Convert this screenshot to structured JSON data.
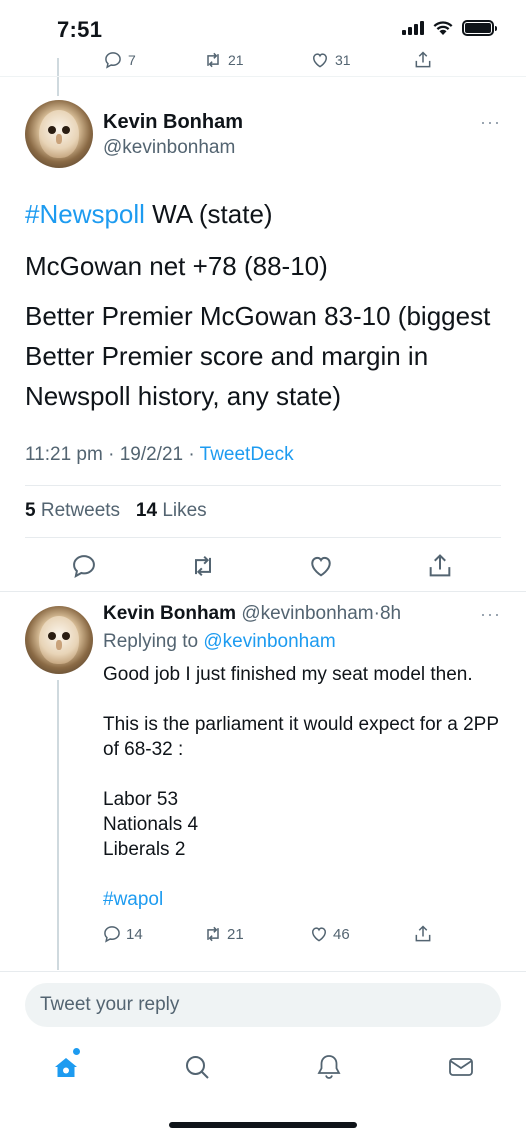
{
  "status_bar": {
    "time": "7:51",
    "icons": [
      "cellular-signal-icon",
      "wifi-icon",
      "battery-icon"
    ]
  },
  "previous_tweet": {
    "actions": [
      {
        "icon": "reply-icon",
        "count": "7"
      },
      {
        "icon": "retweet-icon",
        "count": "21"
      },
      {
        "icon": "like-icon",
        "count": "31"
      },
      {
        "icon": "share-icon",
        "count": ""
      }
    ]
  },
  "main_tweet": {
    "author_name": "Kevin Bonham",
    "author_handle": "@kevinbonham",
    "more": "···",
    "hashtag": "#Newspoll",
    "line1_rest": " WA (state)",
    "line2": "McGowan net +78 (88-10)",
    "line3": "Better Premier McGowan 83-10 (biggest Better Premier score and margin in Newspoll history, any state)",
    "timestamp": "11:21 pm · 19/2/21 · ",
    "client": "TweetDeck",
    "retweet_count": "5",
    "retweet_label": "Retweets",
    "like_count": "14",
    "like_label": "Likes"
  },
  "reply": {
    "author_name": "Kevin Bonham",
    "author_handle": "@kevinbonham",
    "separator": "·",
    "time_ago": "8h",
    "more": "···",
    "replying_prefix": "Replying to ",
    "replying_to": "@kevinbonham",
    "line1": "Good job I just finished my seat model then.",
    "line2": "This is the parliament it would expect for a 2PP of 68-32 :",
    "line3": "Labor 53",
    "line4": "Nationals 4",
    "line5": "Liberals 2",
    "hashtag": "#wapol",
    "reply_count": "14",
    "retweet_count": "21",
    "like_count": "46"
  },
  "composer": {
    "placeholder": "Tweet your reply"
  },
  "tab_bar": {
    "tabs": [
      "home-icon",
      "search-icon",
      "notifications-icon",
      "messages-icon"
    ]
  },
  "colors": {
    "accent": "#1d9bf0",
    "text": "#0f1419",
    "muted": "#536471"
  }
}
